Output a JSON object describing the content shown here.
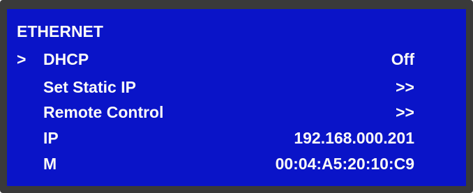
{
  "screen": {
    "title": "ETHERNET",
    "cursor": ">",
    "menu": [
      {
        "label": "DHCP",
        "value": "Off"
      },
      {
        "label": "Set Static IP",
        "value": ">>"
      },
      {
        "label": "Remote Control",
        "value": ">>"
      },
      {
        "label": "IP",
        "value": "192.168.000.201"
      },
      {
        "label": "M",
        "value": "00:04:A5:20:10:C9"
      }
    ]
  },
  "colors": {
    "screen_background": "#0a14c8",
    "text": "#fbfbf8",
    "bezel": "#3a3a3a"
  }
}
